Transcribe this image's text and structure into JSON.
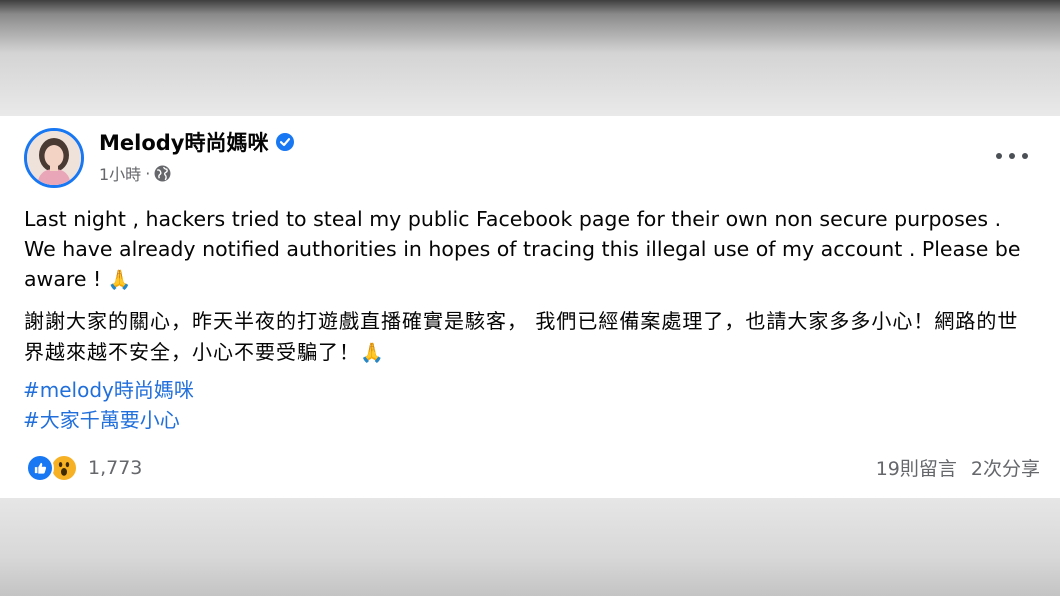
{
  "post": {
    "author": "Melody時尚媽咪",
    "timestamp": "1小時",
    "privacy_icon": "globe-icon",
    "verified_icon": "verified-badge-icon",
    "more_icon": "more-options-icon",
    "body_en": "Last night , hackers tried to steal my public Facebook page for their own non secure purposes . We have already notified authorities in hopes of tracing this illegal use of my account . Please be aware ! ",
    "body_en_emoji": "🙏",
    "body_zh": "謝謝大家的關心，昨天半夜的打遊戲直播確實是駭客， 我們已經備案處理了，也請大家多多小心！網路的世界越來越不安全，小心不要受騙了！",
    "body_zh_emoji": "🙏",
    "hashtags": [
      "#melody時尚媽咪",
      "#大家千萬要小心"
    ]
  },
  "footer": {
    "reaction_icons": [
      "like-icon",
      "wow-icon"
    ],
    "reaction_count": "1,773",
    "comments": "19則留言",
    "shares": "2次分享"
  },
  "colors": {
    "verified": "#1877f2",
    "hashtag": "#216fdb",
    "secondary_text": "#65676b"
  }
}
